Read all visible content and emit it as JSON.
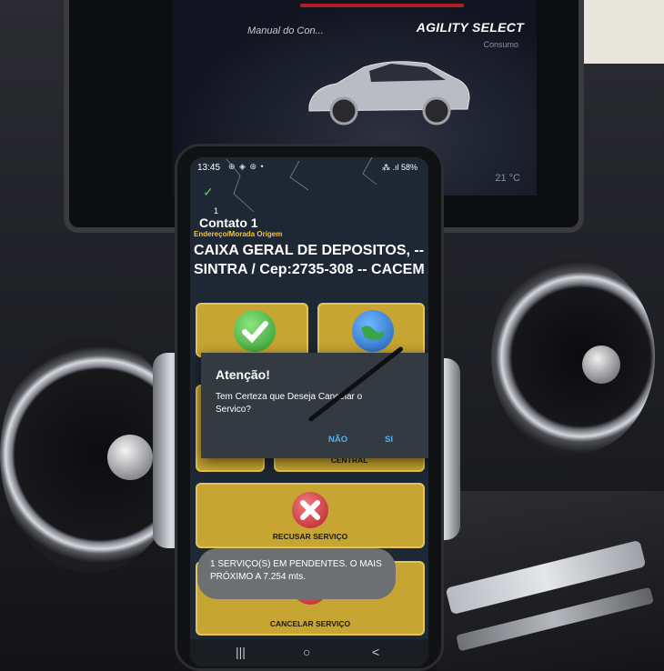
{
  "dashboard": {
    "left_text": "Manual do Con...",
    "right_title": "AGILITY SELECT",
    "sub_label": "Consumo",
    "temperature": "21 °C"
  },
  "phone": {
    "status": {
      "time": "13:45",
      "icons": "⊕ ◈ ⊛ •",
      "right": "⁂ .ıl 58%"
    },
    "counter": "1",
    "contact_title": "Contato 1",
    "contact_label": "Endereço/Morada Origem",
    "address": "CAIXA GERAL DE DEPOSITOS, -- SINTRA / Cep:2735-308 -- CACEM",
    "tiles": {
      "central_label": "CENTRAL",
      "refuse_label": "RECUSAR SERVIÇO",
      "cancel_label": "CANCELAR SERVIÇO"
    },
    "dialog": {
      "title": "Atenção!",
      "message": "Tem Certeza que Deseja Cancelar o Servico?",
      "no_label": "NÃO",
      "yes_label": "SI"
    },
    "toast": "1 SERVIÇO(S) EM PENDENTES. O MAIS PRÓXIMO A 7.254 mts.",
    "nav": {
      "recents": "|||",
      "home": "○",
      "back": "<"
    }
  },
  "colors": {
    "tile": "#c7a532",
    "dialog_bg": "#343a42",
    "dialog_button": "#5ab0e6",
    "label_orange": "#f3c63d",
    "check_green": "#5ccf52",
    "cancel_red": "#c9353b"
  }
}
